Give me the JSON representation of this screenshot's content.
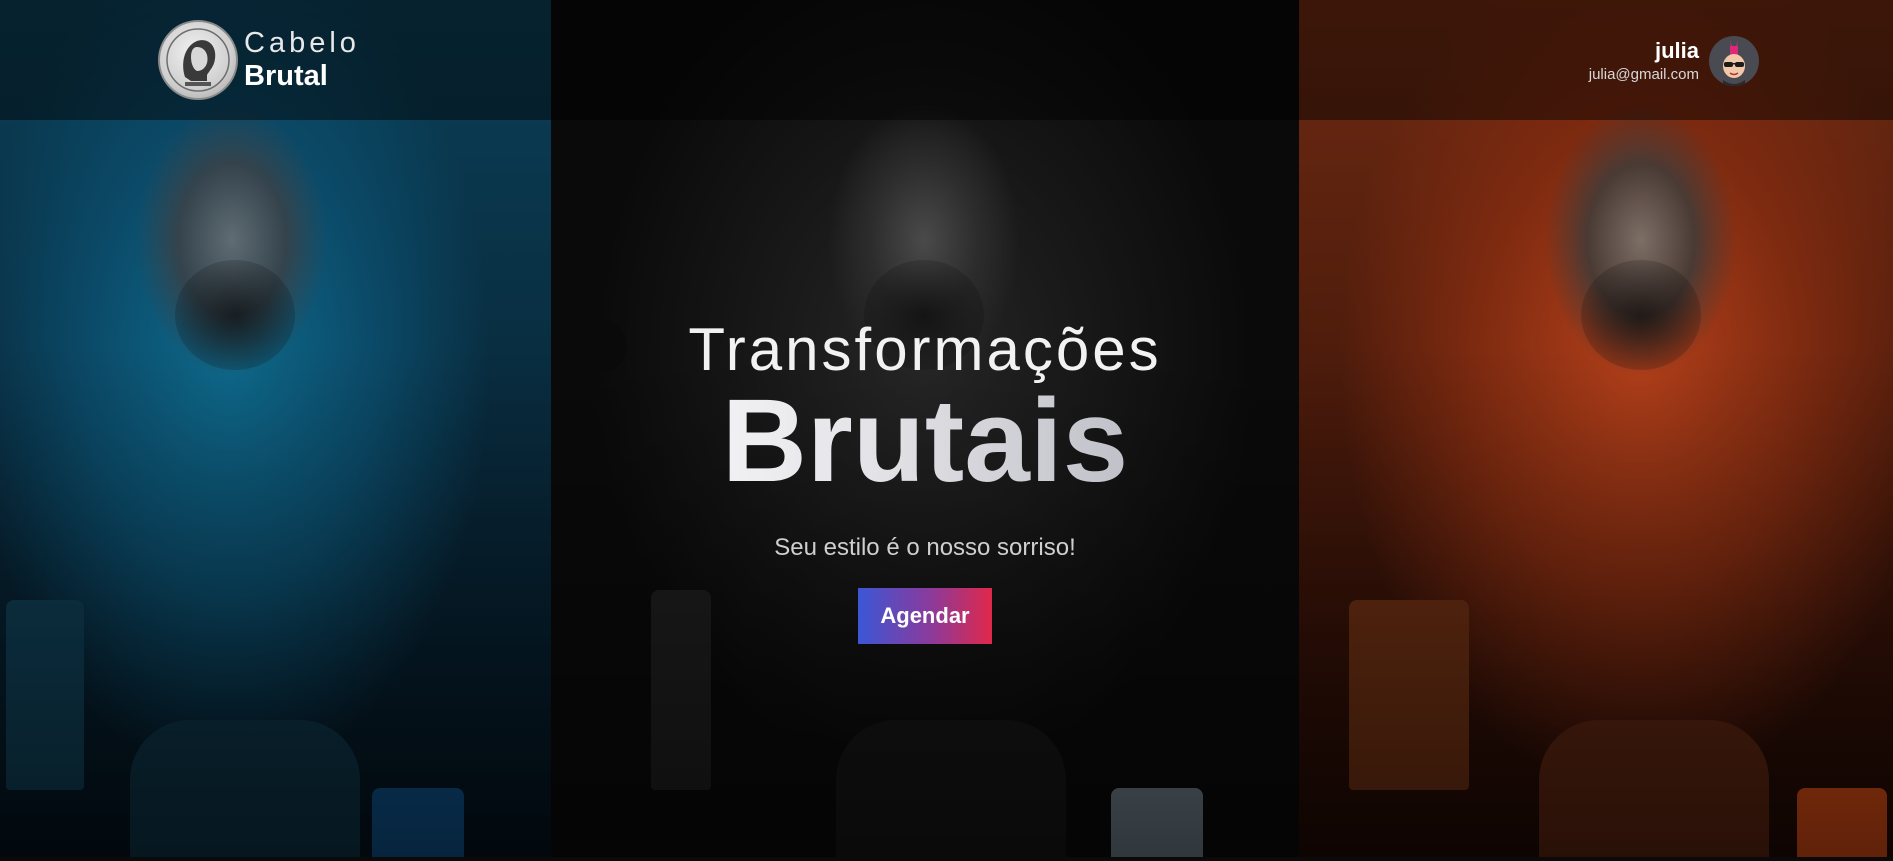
{
  "header": {
    "brand_line1": "Cabelo",
    "brand_line2": "Brutal",
    "logo_icon": "portrait-medallion-icon"
  },
  "user": {
    "name": "julia",
    "email": "julia@gmail.com",
    "avatar_icon": "punk-avatar-icon"
  },
  "hero": {
    "title_line1": "Transformações",
    "title_line2": "Brutais",
    "subtitle": "Seu estilo é o nosso sorriso!",
    "cta_label": "Agendar"
  },
  "colors": {
    "panel_left": "#0b4a68",
    "panel_mid": "#151515",
    "panel_right": "#b5401a",
    "cta_gradient_start": "#3b57d6",
    "cta_gradient_end": "#e0284a"
  }
}
